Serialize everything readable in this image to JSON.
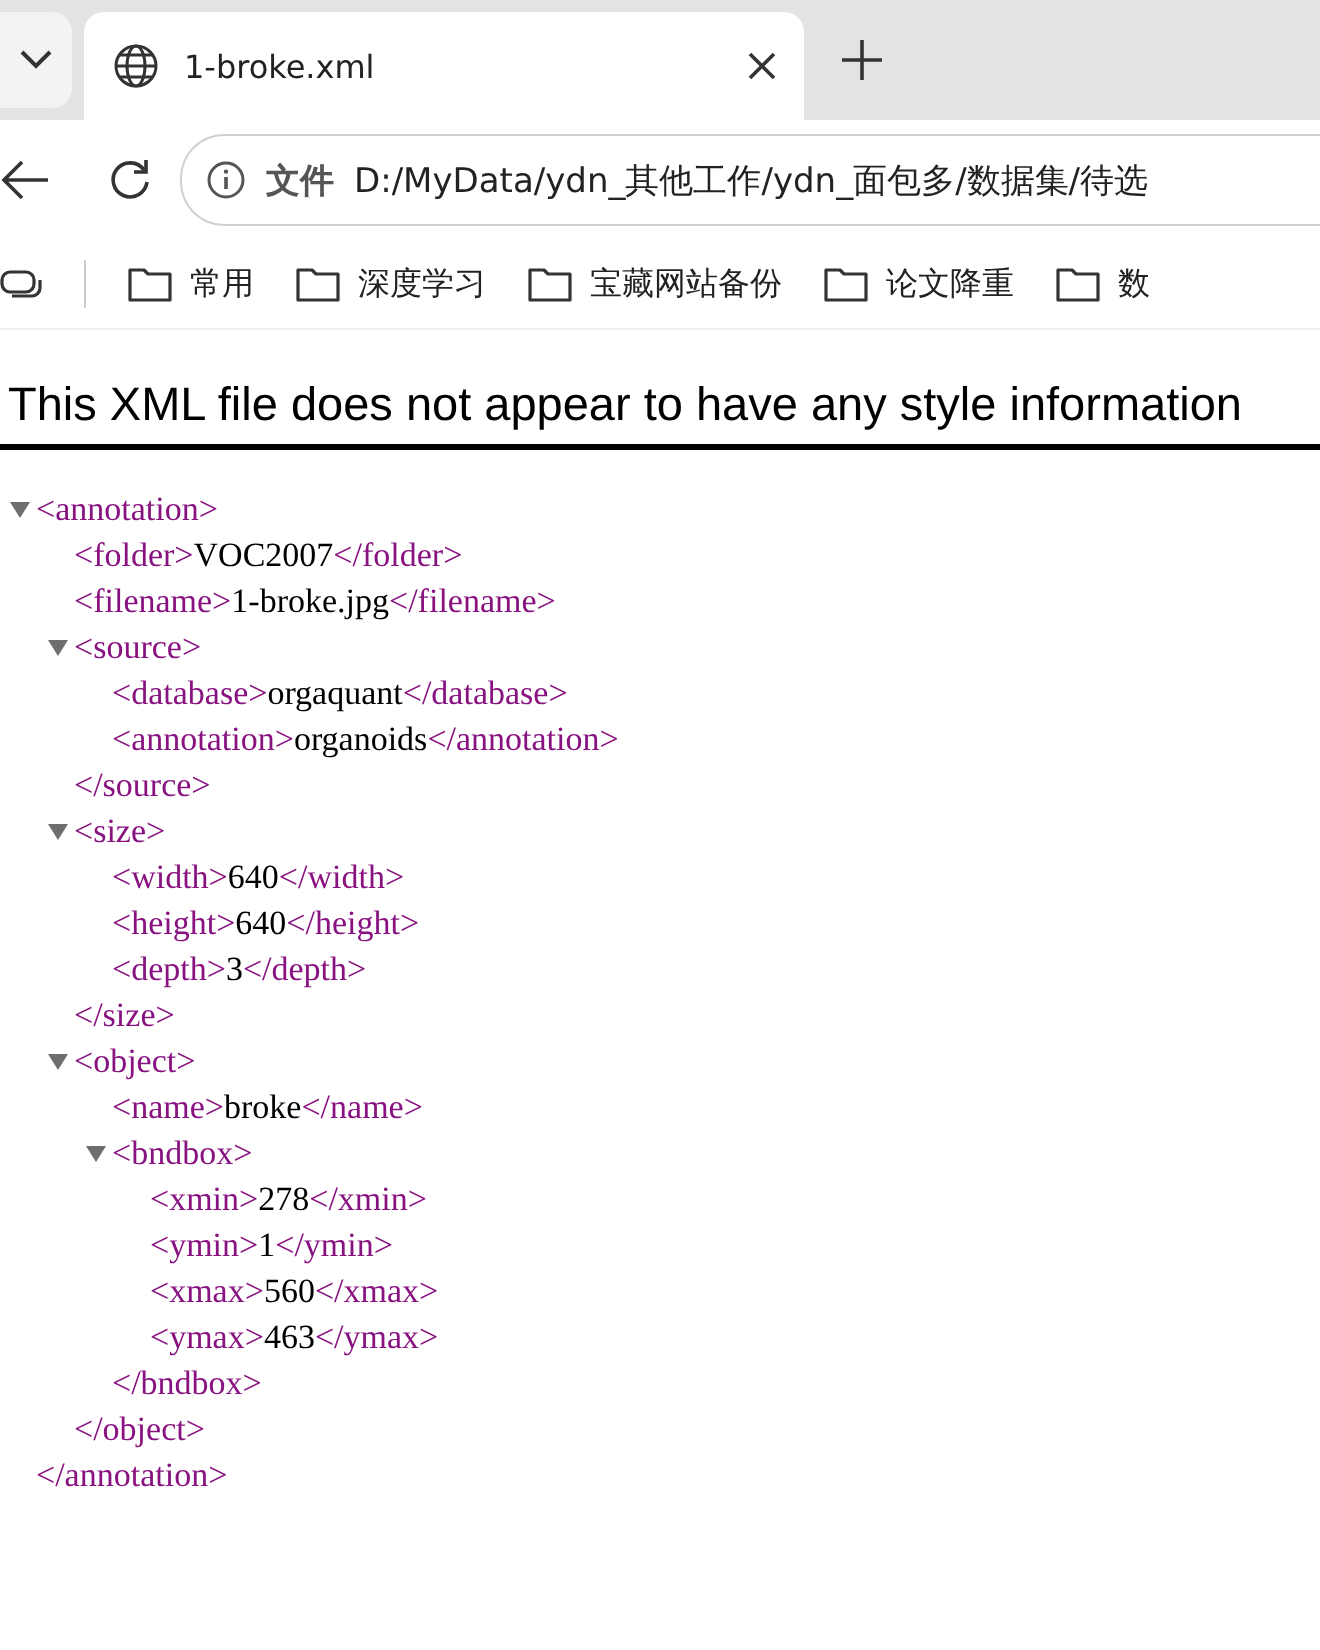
{
  "tabs": [
    {
      "title": "1-broke.xml",
      "selected": true
    }
  ],
  "address_bar": {
    "scheme_label": "文件",
    "url": "D:/MyData/ydn_其他工作/ydn_面包多/数据集/待选"
  },
  "bookmarks": [
    {
      "label": "常用"
    },
    {
      "label": "深度学习"
    },
    {
      "label": "宝藏网站备份"
    },
    {
      "label": "论文降重"
    },
    {
      "label": "数"
    }
  ],
  "page": {
    "notice": "This XML file does not appear to have any style information",
    "tree": [
      {
        "open": "<annotation>",
        "close": "</annotation>",
        "expanded": true,
        "children": [
          {
            "open": "<folder>",
            "value": "VOC2007",
            "close": "</folder>"
          },
          {
            "open": "<filename>",
            "value": "1-broke.jpg",
            "close": "</filename>"
          },
          {
            "open": "<source>",
            "close": "</source>",
            "expanded": true,
            "children": [
              {
                "open": "<database>",
                "value": "orgaquant",
                "close": "</database>"
              },
              {
                "open": "<annotation>",
                "value": "organoids",
                "close": "</annotation>"
              }
            ]
          },
          {
            "open": "<size>",
            "close": "</size>",
            "expanded": true,
            "children": [
              {
                "open": "<width>",
                "value": "640",
                "close": "</width>"
              },
              {
                "open": "<height>",
                "value": "640",
                "close": "</height>"
              },
              {
                "open": "<depth>",
                "value": "3",
                "close": "</depth>"
              }
            ]
          },
          {
            "open": "<object>",
            "close": "</object>",
            "expanded": true,
            "children": [
              {
                "open": "<name>",
                "value": "broke",
                "close": "</name>"
              },
              {
                "open": "<bndbox>",
                "close": "</bndbox>",
                "expanded": true,
                "children": [
                  {
                    "open": "<xmin>",
                    "value": "278",
                    "close": "</xmin>"
                  },
                  {
                    "open": "<ymin>",
                    "value": "1",
                    "close": "</ymin>"
                  },
                  {
                    "open": "<xmax>",
                    "value": "560",
                    "close": "</xmax>"
                  },
                  {
                    "open": "<ymax>",
                    "value": "463",
                    "close": "</ymax>"
                  }
                ]
              }
            ]
          }
        ]
      }
    ]
  }
}
